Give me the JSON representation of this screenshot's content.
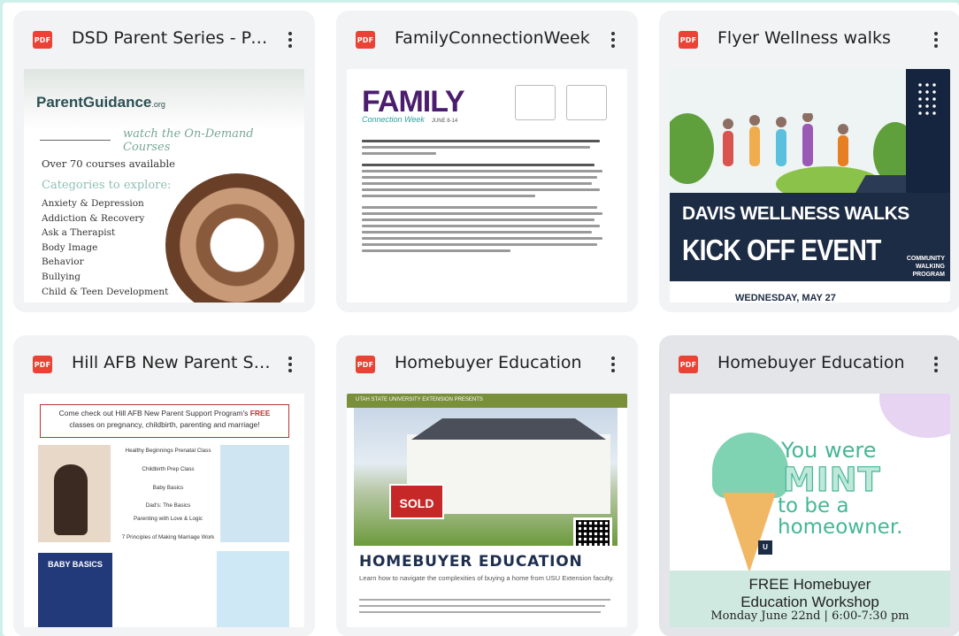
{
  "files": [
    {
      "type_label": "PDF",
      "title": "DSD Parent Series - Parent Guidance"
    },
    {
      "type_label": "PDF",
      "title": "FamilyConnectionWeek"
    },
    {
      "type_label": "PDF",
      "title": "Flyer Wellness walks"
    },
    {
      "type_label": "PDF",
      "title": "Hill AFB New Parent Support"
    },
    {
      "type_label": "PDF",
      "title": "Homebuyer Education"
    },
    {
      "type_label": "PDF",
      "title": "Homebuyer Education"
    }
  ],
  "thumb_parent_guidance": {
    "logo": "ParentGuidance",
    "logo_suffix": ".org",
    "script_text": "watch the On-Demand Courses",
    "courses": "Over 70 courses available",
    "categories_heading": "Categories to explore:",
    "categories": [
      "Anxiety & Depression",
      "Addiction & Recovery",
      "Ask a Therapist",
      "Body Image",
      "Behavior",
      "Bullying",
      "Child & Teen Development"
    ]
  },
  "thumb_family": {
    "title": "FAMILY",
    "subtitle": "Connection Week",
    "dates": "JUNE 8-14"
  },
  "thumb_wellness": {
    "line1": "DAVIS WELLNESS WALKS",
    "line2": "KICK OFF EVENT",
    "program": "COMMUNITY WALKING PROGRAM",
    "date": "WEDNESDAY, MAY 27"
  },
  "thumb_hafb": {
    "intro_pre": "Come check out Hill AFB New Parent Support Program's ",
    "intro_free": "FREE",
    "intro_post": " classes on pregnancy, childbirth, parenting and marriage!",
    "items": [
      "Healthy Beginnings Prenatal Class",
      "Childbirth Prep Class",
      "Baby Basics",
      "Dad's: The Basics",
      "Parenting with Love & Logic",
      "7 Principles of Making Marriage Work"
    ],
    "poster_title": "BABY BASICS"
  },
  "thumb_homebuyer": {
    "header": "UTAH STATE UNIVERSITY EXTENSION PRESENTS",
    "sign": "SOLD",
    "title": "HOMEBUYER EDUCATION",
    "subtitle": "Learn how to navigate the complexities of buying a home from USU Extension faculty."
  },
  "thumb_mint": {
    "you_were": "You were",
    "mint": "MINT",
    "to_be_a": "to be a",
    "homeowner": "homeowner.",
    "free_line": "FREE Homebuyer",
    "workshop_line": "Education Workshop",
    "date_line": "Monday June 22nd  |  6:00-7:30 pm"
  },
  "colors": {
    "pdf_icon": "#ea4335",
    "card_bg": "#f1f3f4",
    "card_selected_bg": "#e3e5e8",
    "page_border": "#cdf0ea"
  },
  "icons": {
    "file_type": "pdf-icon",
    "more": "more-vert-icon"
  }
}
